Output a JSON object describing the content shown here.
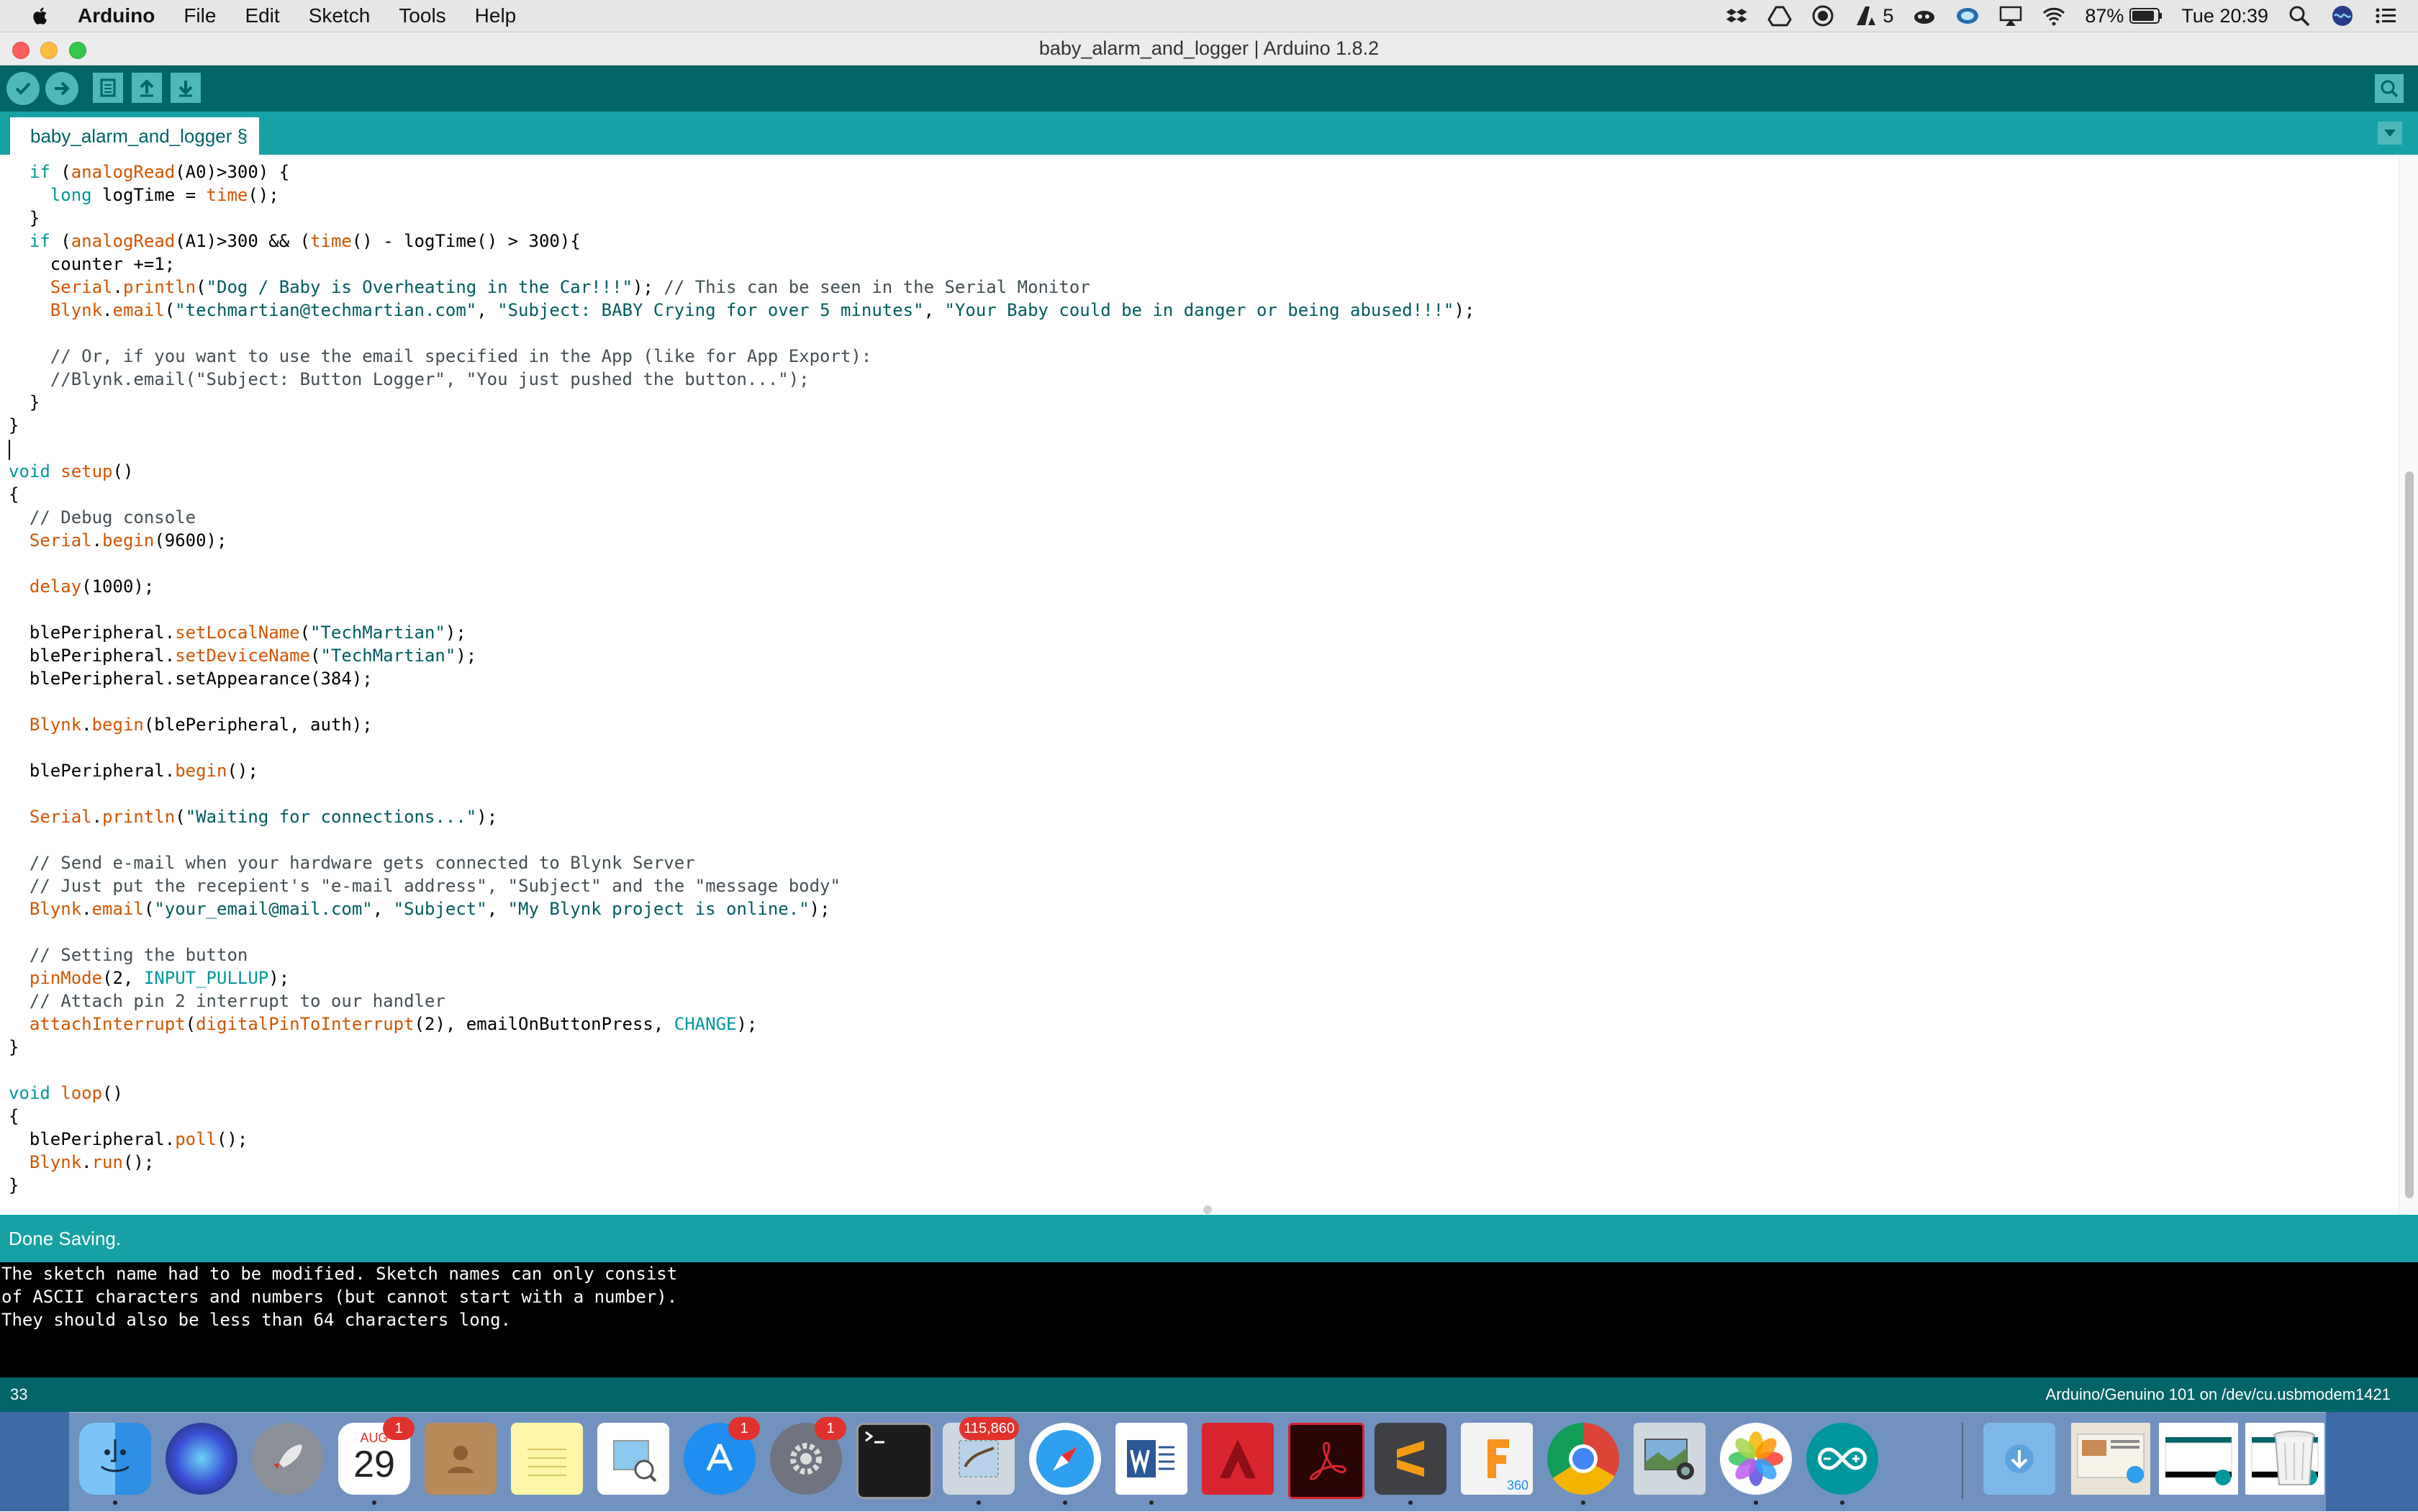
{
  "menubar": {
    "app_name": "Arduino",
    "items": [
      "File",
      "Edit",
      "Sketch",
      "Tools",
      "Help"
    ],
    "status": {
      "adobe_count": "5",
      "battery": "87%",
      "clock": "Tue 20:39"
    }
  },
  "window": {
    "title": "baby_alarm_and_logger | Arduino 1.8.2"
  },
  "tab": {
    "label": "baby_alarm_and_logger §"
  },
  "code_lines": [
    {
      "segs": [
        {
          "t": "  "
        },
        {
          "t": "if",
          "c": "kw"
        },
        {
          "t": " ("
        },
        {
          "t": "analogRead",
          "c": "fn"
        },
        {
          "t": "(A0)>300) {"
        }
      ]
    },
    {
      "segs": [
        {
          "t": "    "
        },
        {
          "t": "long",
          "c": "kw"
        },
        {
          "t": " logTime = "
        },
        {
          "t": "time",
          "c": "fn"
        },
        {
          "t": "();"
        }
      ]
    },
    {
      "segs": [
        {
          "t": "  }"
        }
      ]
    },
    {
      "segs": [
        {
          "t": "  "
        },
        {
          "t": "if",
          "c": "kw"
        },
        {
          "t": " ("
        },
        {
          "t": "analogRead",
          "c": "fn"
        },
        {
          "t": "(A1)>300 && ("
        },
        {
          "t": "time",
          "c": "fn"
        },
        {
          "t": "() - logTime() > 300){"
        }
      ]
    },
    {
      "segs": [
        {
          "t": "    counter +=1;"
        }
      ]
    },
    {
      "segs": [
        {
          "t": "    "
        },
        {
          "t": "Serial",
          "c": "fn"
        },
        {
          "t": "."
        },
        {
          "t": "println",
          "c": "fn"
        },
        {
          "t": "("
        },
        {
          "t": "\"Dog / Baby is Overheating in the Car!!!\"",
          "c": "str"
        },
        {
          "t": "); "
        },
        {
          "t": "// This can be seen in the Serial Monitor",
          "c": "cm"
        }
      ]
    },
    {
      "segs": [
        {
          "t": "    "
        },
        {
          "t": "Blynk",
          "c": "fn"
        },
        {
          "t": "."
        },
        {
          "t": "email",
          "c": "fn"
        },
        {
          "t": "("
        },
        {
          "t": "\"techmartian@techmartian.com\"",
          "c": "str"
        },
        {
          "t": ", "
        },
        {
          "t": "\"Subject: BABY Crying for over 5 minutes\"",
          "c": "str"
        },
        {
          "t": ", "
        },
        {
          "t": "\"Your Baby could be in danger or being abused!!!\"",
          "c": "str"
        },
        {
          "t": ");"
        }
      ]
    },
    {
      "segs": [
        {
          "t": ""
        }
      ]
    },
    {
      "segs": [
        {
          "t": "    "
        },
        {
          "t": "// Or, if you want to use the email specified in the App (like for App Export):",
          "c": "cm"
        }
      ]
    },
    {
      "segs": [
        {
          "t": "    "
        },
        {
          "t": "//Blynk.email(\"Subject: Button Logger\", \"You just pushed the button...\");",
          "c": "cm"
        }
      ]
    },
    {
      "segs": [
        {
          "t": "  }"
        }
      ]
    },
    {
      "segs": [
        {
          "t": "}"
        }
      ]
    },
    {
      "segs": [
        {
          "t": ""
        }
      ]
    },
    {
      "segs": [
        {
          "t": "void",
          "c": "kw"
        },
        {
          "t": " "
        },
        {
          "t": "setup",
          "c": "fn"
        },
        {
          "t": "()"
        }
      ]
    },
    {
      "segs": [
        {
          "t": "{"
        }
      ]
    },
    {
      "segs": [
        {
          "t": "  "
        },
        {
          "t": "// Debug console",
          "c": "cm"
        }
      ]
    },
    {
      "segs": [
        {
          "t": "  "
        },
        {
          "t": "Serial",
          "c": "fn"
        },
        {
          "t": "."
        },
        {
          "t": "begin",
          "c": "fn"
        },
        {
          "t": "(9600);"
        }
      ]
    },
    {
      "segs": [
        {
          "t": ""
        }
      ]
    },
    {
      "segs": [
        {
          "t": "  "
        },
        {
          "t": "delay",
          "c": "fn"
        },
        {
          "t": "(1000);"
        }
      ]
    },
    {
      "segs": [
        {
          "t": ""
        }
      ]
    },
    {
      "segs": [
        {
          "t": "  blePeripheral."
        },
        {
          "t": "setLocalName",
          "c": "fn"
        },
        {
          "t": "("
        },
        {
          "t": "\"TechMartian\"",
          "c": "str"
        },
        {
          "t": ");"
        }
      ]
    },
    {
      "segs": [
        {
          "t": "  blePeripheral."
        },
        {
          "t": "setDeviceName",
          "c": "fn"
        },
        {
          "t": "("
        },
        {
          "t": "\"TechMartian\"",
          "c": "str"
        },
        {
          "t": ");"
        }
      ]
    },
    {
      "segs": [
        {
          "t": "  blePeripheral.setAppearance(384);"
        }
      ]
    },
    {
      "segs": [
        {
          "t": ""
        }
      ]
    },
    {
      "segs": [
        {
          "t": "  "
        },
        {
          "t": "Blynk",
          "c": "fn"
        },
        {
          "t": "."
        },
        {
          "t": "begin",
          "c": "fn"
        },
        {
          "t": "(blePeripheral, auth);"
        }
      ]
    },
    {
      "segs": [
        {
          "t": ""
        }
      ]
    },
    {
      "segs": [
        {
          "t": "  blePeripheral."
        },
        {
          "t": "begin",
          "c": "fn"
        },
        {
          "t": "();"
        }
      ]
    },
    {
      "segs": [
        {
          "t": ""
        }
      ]
    },
    {
      "segs": [
        {
          "t": "  "
        },
        {
          "t": "Serial",
          "c": "fn"
        },
        {
          "t": "."
        },
        {
          "t": "println",
          "c": "fn"
        },
        {
          "t": "("
        },
        {
          "t": "\"Waiting for connections...\"",
          "c": "str"
        },
        {
          "t": ");"
        }
      ]
    },
    {
      "segs": [
        {
          "t": ""
        }
      ]
    },
    {
      "segs": [
        {
          "t": "  "
        },
        {
          "t": "// Send e-mail when your hardware gets connected to Blynk Server",
          "c": "cm"
        }
      ]
    },
    {
      "segs": [
        {
          "t": "  "
        },
        {
          "t": "// Just put the recepient's \"e-mail address\", \"Subject\" and the \"message body\"",
          "c": "cm"
        }
      ]
    },
    {
      "segs": [
        {
          "t": "  "
        },
        {
          "t": "Blynk",
          "c": "fn"
        },
        {
          "t": "."
        },
        {
          "t": "email",
          "c": "fn"
        },
        {
          "t": "("
        },
        {
          "t": "\"your_email@mail.com\"",
          "c": "str"
        },
        {
          "t": ", "
        },
        {
          "t": "\"Subject\"",
          "c": "str"
        },
        {
          "t": ", "
        },
        {
          "t": "\"My Blynk project is online.\"",
          "c": "str"
        },
        {
          "t": ");"
        }
      ]
    },
    {
      "segs": [
        {
          "t": ""
        }
      ]
    },
    {
      "segs": [
        {
          "t": "  "
        },
        {
          "t": "// Setting the button",
          "c": "cm"
        }
      ]
    },
    {
      "segs": [
        {
          "t": "  "
        },
        {
          "t": "pinMode",
          "c": "fn"
        },
        {
          "t": "(2, "
        },
        {
          "t": "INPUT_PULLUP",
          "c": "con"
        },
        {
          "t": ");"
        }
      ]
    },
    {
      "segs": [
        {
          "t": "  "
        },
        {
          "t": "// Attach pin 2 interrupt to our handler",
          "c": "cm"
        }
      ]
    },
    {
      "segs": [
        {
          "t": "  "
        },
        {
          "t": "attachInterrupt",
          "c": "fn"
        },
        {
          "t": "("
        },
        {
          "t": "digitalPinToInterrupt",
          "c": "fn"
        },
        {
          "t": "(2), emailOnButtonPress, "
        },
        {
          "t": "CHANGE",
          "c": "con"
        },
        {
          "t": ");"
        }
      ]
    },
    {
      "segs": [
        {
          "t": "}"
        }
      ]
    },
    {
      "segs": [
        {
          "t": ""
        }
      ]
    },
    {
      "segs": [
        {
          "t": "void",
          "c": "kw"
        },
        {
          "t": " "
        },
        {
          "t": "loop",
          "c": "fn"
        },
        {
          "t": "()"
        }
      ]
    },
    {
      "segs": [
        {
          "t": "{"
        }
      ]
    },
    {
      "segs": [
        {
          "t": "  blePeripheral."
        },
        {
          "t": "poll",
          "c": "fn"
        },
        {
          "t": "();"
        }
      ]
    },
    {
      "segs": [
        {
          "t": "  "
        },
        {
          "t": "Blynk",
          "c": "fn"
        },
        {
          "t": "."
        },
        {
          "t": "run",
          "c": "fn"
        },
        {
          "t": "();"
        }
      ]
    },
    {
      "segs": [
        {
          "t": "}"
        }
      ]
    }
  ],
  "status": {
    "message": "Done Saving."
  },
  "console": {
    "lines": [
      "The sketch name had to be modified. Sketch names can only consist",
      "of ASCII characters and numbers (but cannot start with a number).",
      "They should also be less than 64 characters long."
    ]
  },
  "footer": {
    "line_number": "33",
    "board": "Arduino/Genuino 101 on /dev/cu.usbmodem1421"
  },
  "dock": {
    "calendar_month": "AUG",
    "calendar_day": "29",
    "calendar_badge": "1",
    "appstore_badge": "1",
    "prefs_badge": "1",
    "mail_badge": "115,860",
    "fusion_label": "360",
    "items": [
      "finder-icon",
      "siri-icon",
      "launchpad-icon",
      "calendar-icon",
      "contacts-icon",
      "notes-icon",
      "preview-icon",
      "app-store-icon",
      "system-preferences-icon",
      "terminal-icon",
      "mail-icon",
      "safari-icon",
      "word-icon",
      "autocad-icon",
      "acrobat-icon",
      "sublime-text-icon",
      "fusion-360-icon",
      "chrome-icon",
      "image-capture-icon",
      "photos-icon",
      "arduino-icon",
      "downloads-stack-icon",
      "minimized-window-icon",
      "arduino-window-icon",
      "arduino-window-icon",
      "trash-icon"
    ],
    "colors": {
      "teal_dark": "#006468",
      "teal": "#17a1a5",
      "teal_light": "#4db7bb"
    }
  }
}
